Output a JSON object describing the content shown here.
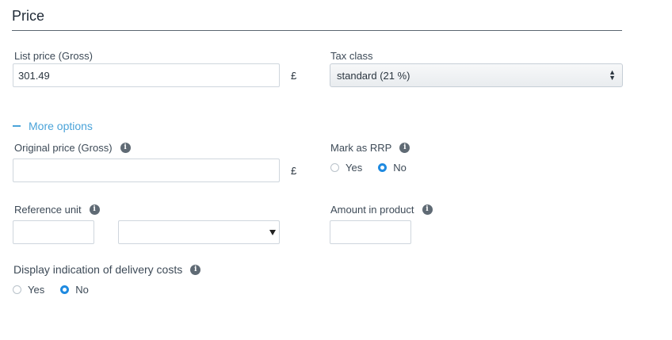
{
  "section": {
    "title": "Price"
  },
  "list_price": {
    "label": "List price (Gross)",
    "value": "301.49",
    "currency": "£"
  },
  "tax_class": {
    "label": "Tax class",
    "selected": "standard (21 %)"
  },
  "more_options": {
    "label": "More options"
  },
  "original_price": {
    "label": "Original price (Gross)",
    "value": "",
    "currency": "£"
  },
  "mark_as_rrp": {
    "label": "Mark as RRP",
    "yes": "Yes",
    "no": "No",
    "selected": "No"
  },
  "reference_unit": {
    "label": "Reference unit",
    "value": "",
    "unit_selected": ""
  },
  "amount_in_product": {
    "label": "Amount in product",
    "value": ""
  },
  "delivery_costs": {
    "label": "Display indication of delivery costs",
    "yes": "Yes",
    "no": "No",
    "selected": "No"
  },
  "colors": {
    "accent": "#4aa3d9",
    "radio_checked": "#1f8ae0",
    "info_icon": "#5f6a74"
  }
}
